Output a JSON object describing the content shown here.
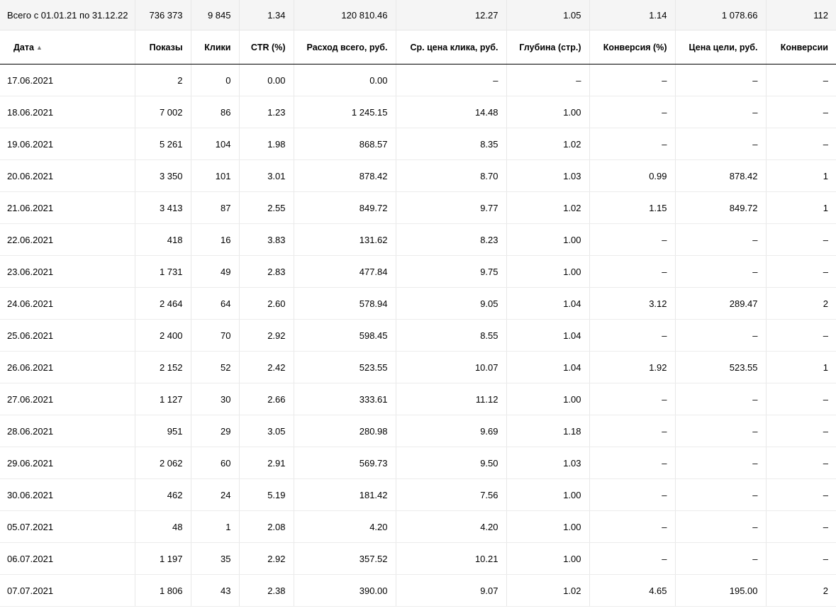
{
  "totals": {
    "label": "Всего с 01.01.21 по 31.12.22",
    "values": [
      "736 373",
      "9 845",
      "1.34",
      "120 810.46",
      "12.27",
      "1.05",
      "1.14",
      "1 078.66",
      "112"
    ]
  },
  "columns": [
    "Дата",
    "Показы",
    "Клики",
    "CTR (%)",
    "Расход всего, руб.",
    "Ср. цена клика, руб.",
    "Глубина (стр.)",
    "Конверсия (%)",
    "Цена цели, руб.",
    "Конверсии"
  ],
  "sort_icon": "▲",
  "rows": [
    [
      "17.06.2021",
      "2",
      "0",
      "0.00",
      "0.00",
      "–",
      "–",
      "–",
      "–",
      "–"
    ],
    [
      "18.06.2021",
      "7 002",
      "86",
      "1.23",
      "1 245.15",
      "14.48",
      "1.00",
      "–",
      "–",
      "–"
    ],
    [
      "19.06.2021",
      "5 261",
      "104",
      "1.98",
      "868.57",
      "8.35",
      "1.02",
      "–",
      "–",
      "–"
    ],
    [
      "20.06.2021",
      "3 350",
      "101",
      "3.01",
      "878.42",
      "8.70",
      "1.03",
      "0.99",
      "878.42",
      "1"
    ],
    [
      "21.06.2021",
      "3 413",
      "87",
      "2.55",
      "849.72",
      "9.77",
      "1.02",
      "1.15",
      "849.72",
      "1"
    ],
    [
      "22.06.2021",
      "418",
      "16",
      "3.83",
      "131.62",
      "8.23",
      "1.00",
      "–",
      "–",
      "–"
    ],
    [
      "23.06.2021",
      "1 731",
      "49",
      "2.83",
      "477.84",
      "9.75",
      "1.00",
      "–",
      "–",
      "–"
    ],
    [
      "24.06.2021",
      "2 464",
      "64",
      "2.60",
      "578.94",
      "9.05",
      "1.04",
      "3.12",
      "289.47",
      "2"
    ],
    [
      "25.06.2021",
      "2 400",
      "70",
      "2.92",
      "598.45",
      "8.55",
      "1.04",
      "–",
      "–",
      "–"
    ],
    [
      "26.06.2021",
      "2 152",
      "52",
      "2.42",
      "523.55",
      "10.07",
      "1.04",
      "1.92",
      "523.55",
      "1"
    ],
    [
      "27.06.2021",
      "1 127",
      "30",
      "2.66",
      "333.61",
      "11.12",
      "1.00",
      "–",
      "–",
      "–"
    ],
    [
      "28.06.2021",
      "951",
      "29",
      "3.05",
      "280.98",
      "9.69",
      "1.18",
      "–",
      "–",
      "–"
    ],
    [
      "29.06.2021",
      "2 062",
      "60",
      "2.91",
      "569.73",
      "9.50",
      "1.03",
      "–",
      "–",
      "–"
    ],
    [
      "30.06.2021",
      "462",
      "24",
      "5.19",
      "181.42",
      "7.56",
      "1.00",
      "–",
      "–",
      "–"
    ],
    [
      "05.07.2021",
      "48",
      "1",
      "2.08",
      "4.20",
      "4.20",
      "1.00",
      "–",
      "–",
      "–"
    ],
    [
      "06.07.2021",
      "1 197",
      "35",
      "2.92",
      "357.52",
      "10.21",
      "1.00",
      "–",
      "–",
      "–"
    ],
    [
      "07.07.2021",
      "1 806",
      "43",
      "2.38",
      "390.00",
      "9.07",
      "1.02",
      "4.65",
      "195.00",
      "2"
    ]
  ]
}
